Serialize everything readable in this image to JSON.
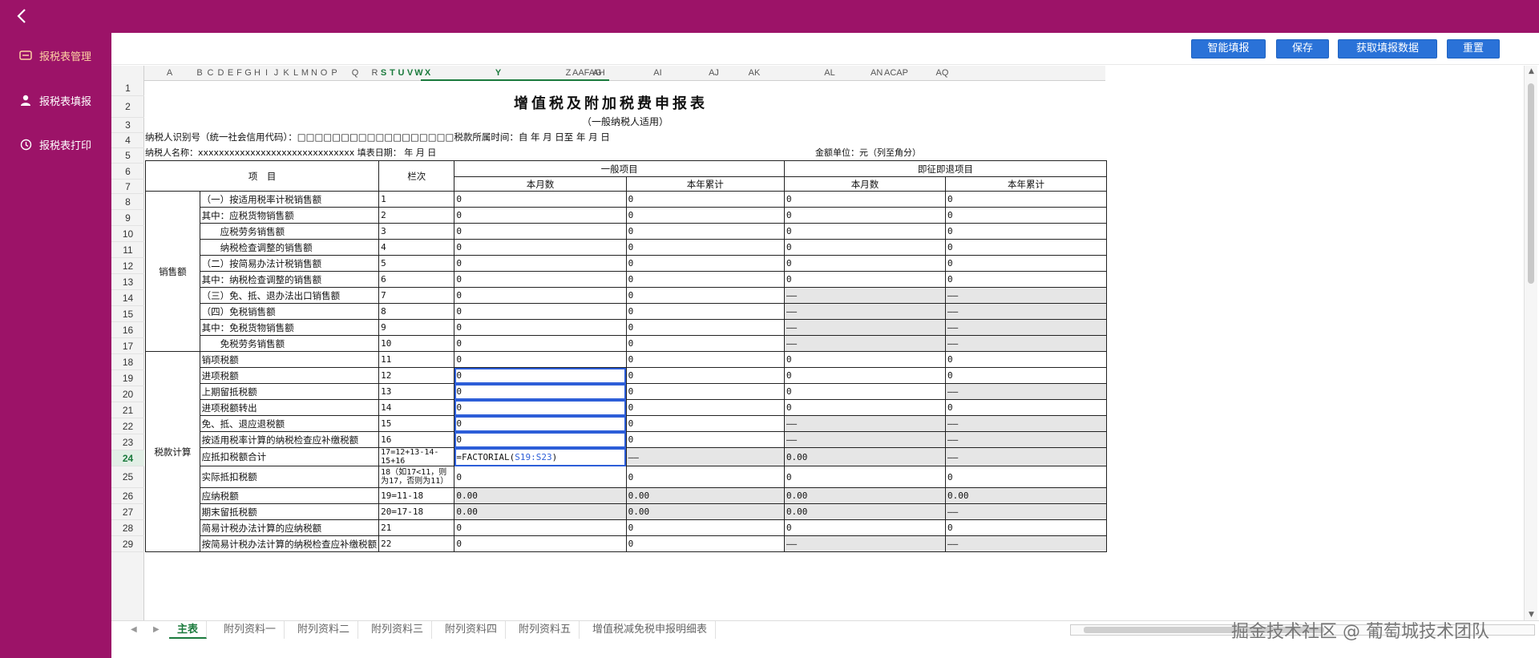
{
  "sidebar": {
    "back_icon": "chevron-left-icon",
    "items": [
      {
        "label": "报税表管理",
        "icon": "table-icon",
        "active": true
      },
      {
        "label": "报税表填报",
        "icon": "user-icon",
        "active": false
      },
      {
        "label": "报税表打印",
        "icon": "print-icon",
        "active": false
      }
    ]
  },
  "toolbar": {
    "smart_fill": "智能填报",
    "save": "保存",
    "fetch": "获取填报数据",
    "reset": "重置"
  },
  "columns": [
    "A",
    "B",
    "C",
    "D",
    "E",
    "F",
    "G",
    "H",
    "I",
    "J",
    "K",
    "L",
    "M",
    "N",
    "O",
    "P",
    "Q",
    "R",
    "S",
    "T",
    "U",
    "V",
    "W",
    "X",
    "Y",
    "Z",
    "AAFAG",
    "AH",
    "AI",
    "AJ",
    "AK",
    "AL",
    "AN",
    "ACAP",
    "AQ"
  ],
  "rows": [
    "1",
    "2",
    "3",
    "4",
    "5",
    "6",
    "7",
    "8",
    "9",
    "10",
    "11",
    "12",
    "13",
    "14",
    "15",
    "16",
    "17",
    "18",
    "19",
    "20",
    "21",
    "22",
    "23",
    "24",
    "25",
    "26",
    "27",
    "28",
    "29"
  ],
  "active_row": "24",
  "form": {
    "title": "增值税及附加税费申报表",
    "subtitle": "（一般纳税人适用）",
    "taxpayer_id_line": "纳税人识别号（统一社会信用代码）：□□□□□□□□□□□□□□□□□□税款所属时间：自    年    月    日至    年    月    日",
    "taxpayer_name_line": "纳税人名称：xxxxxxxxxxxxxxxxxxxxxxxxxxxxxx    填表日期：  年  月  日",
    "unit_line": "金额单位：元（列至角分）",
    "header": {
      "item": "项　目",
      "col_no": "栏次",
      "general": "一般项目",
      "immediate": "即征即退项目",
      "month": "本月数",
      "year": "本年累计"
    },
    "group_sales": "销售额",
    "group_tax": "税款计算",
    "rows": [
      {
        "item": "（一）按适用税率计税销售额",
        "no": "1",
        "v": [
          "0",
          "0",
          "0",
          "0"
        ]
      },
      {
        "item": "其中：应税货物销售额",
        "no": "2",
        "v": [
          "0",
          "0",
          "0",
          "0"
        ]
      },
      {
        "item": "　　应税劳务销售额",
        "no": "3",
        "v": [
          "0",
          "0",
          "0",
          "0"
        ]
      },
      {
        "item": "　　纳税检查调整的销售额",
        "no": "4",
        "v": [
          "0",
          "0",
          "0",
          "0"
        ]
      },
      {
        "item": "（二）按简易办法计税销售额",
        "no": "5",
        "v": [
          "0",
          "0",
          "0",
          "0"
        ]
      },
      {
        "item": "其中：纳税检查调整的销售额",
        "no": "6",
        "v": [
          "0",
          "0",
          "0",
          "0"
        ]
      },
      {
        "item": "（三）免、抵、退办法出口销售额",
        "no": "7",
        "v": [
          "0",
          "0",
          "——",
          "——"
        ]
      },
      {
        "item": "（四）免税销售额",
        "no": "8",
        "v": [
          "0",
          "0",
          "——",
          "——"
        ]
      },
      {
        "item": "其中：免税货物销售额",
        "no": "9",
        "v": [
          "0",
          "0",
          "——",
          "——"
        ]
      },
      {
        "item": "　　免税劳务销售额",
        "no": "10",
        "v": [
          "0",
          "0",
          "——",
          "——"
        ]
      },
      {
        "item": "销项税额",
        "no": "11",
        "v": [
          "0",
          "0",
          "0",
          "0"
        ]
      },
      {
        "item": "进项税额",
        "no": "12",
        "v": [
          "0",
          "0",
          "0",
          "0"
        ]
      },
      {
        "item": "上期留抵税额",
        "no": "13",
        "v": [
          "0",
          "0",
          "0",
          "——"
        ]
      },
      {
        "item": "进项税额转出",
        "no": "14",
        "v": [
          "0",
          "0",
          "0",
          "0"
        ]
      },
      {
        "item": "免、抵、退应退税额",
        "no": "15",
        "v": [
          "0",
          "0",
          "——",
          "——"
        ]
      },
      {
        "item": "按适用税率计算的纳税检查应补缴税额",
        "no": "16",
        "v": [
          "0",
          "0",
          "——",
          "——"
        ]
      },
      {
        "item": "应抵扣税额合计",
        "no": "17=12+13-14-15+16",
        "v": [
          "=FACTORIAL(S19:S23)",
          "——",
          "0.00",
          "——"
        ]
      },
      {
        "item": "实际抵扣税额",
        "no": "18（如17<11，则为17，否则为11）",
        "v": [
          "0",
          "0",
          "0",
          "0"
        ]
      },
      {
        "item": "应纳税额",
        "no": "19=11-18",
        "v": [
          "0.00",
          "0.00",
          "0.00",
          "0.00"
        ]
      },
      {
        "item": "期末留抵税额",
        "no": "20=17-18",
        "v": [
          "0.00",
          "0.00",
          "0.00",
          "——"
        ]
      },
      {
        "item": "简易计税办法计算的应纳税额",
        "no": "21",
        "v": [
          "0",
          "0",
          "0",
          "0"
        ]
      },
      {
        "item": "按简易计税办法计算的纳税检查应补缴税额",
        "no": "22",
        "v": [
          "0",
          "0",
          "——",
          "——"
        ]
      }
    ]
  },
  "tabs": [
    "主表",
    "附列资料一",
    "附列资料二",
    "附列资料三",
    "附列资料四",
    "附列资料五",
    "增值税减免税申报明细表"
  ],
  "active_tab": "主表",
  "watermark": "掘金技术社区 @ 葡萄城技术团队"
}
